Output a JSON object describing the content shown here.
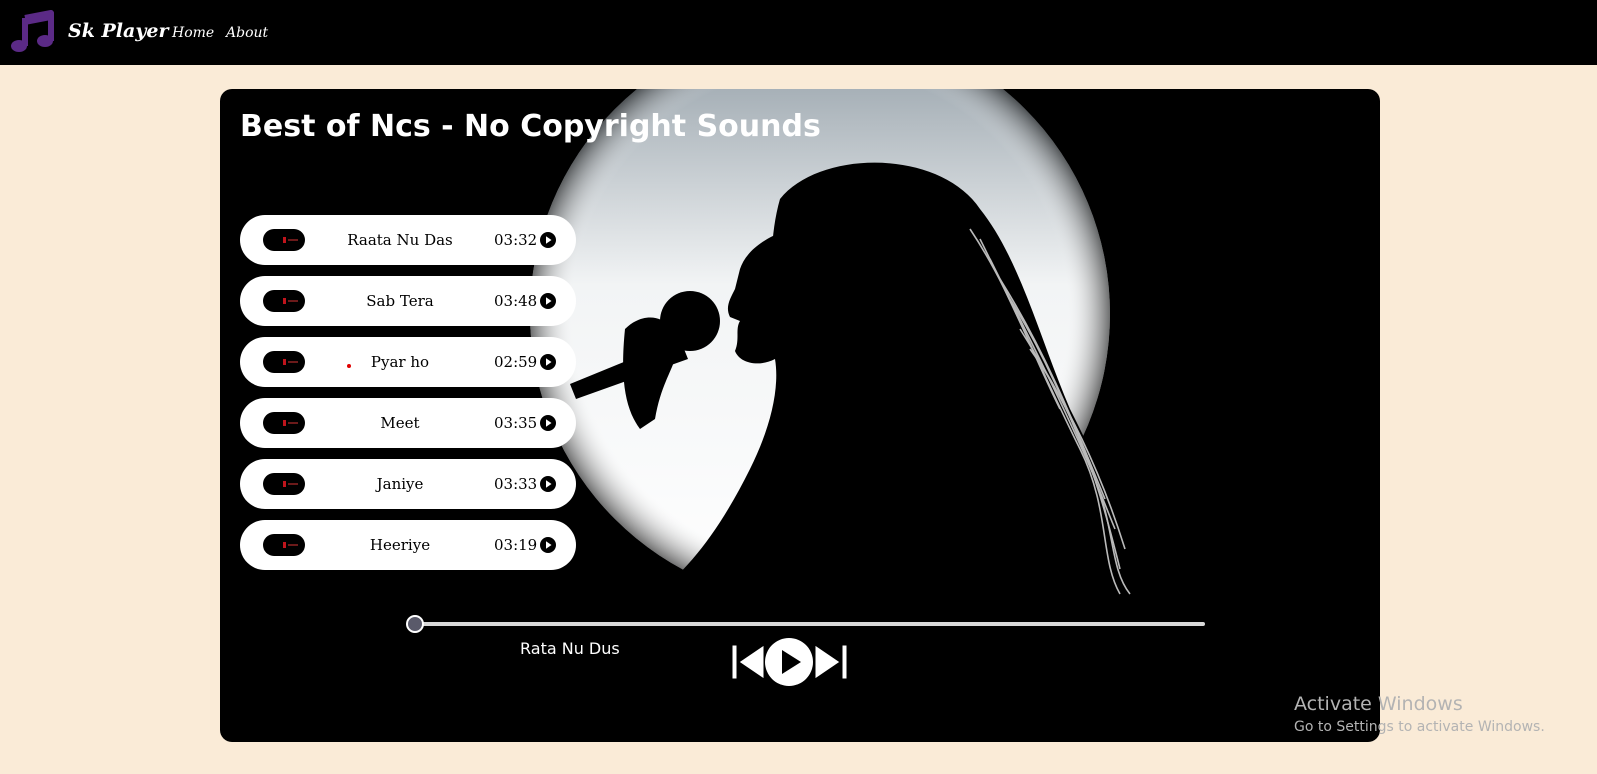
{
  "navbar": {
    "brand": "Sk Player",
    "links": [
      {
        "label": "Home"
      },
      {
        "label": "About"
      }
    ],
    "logo_icon": "music-note-icon",
    "logo_color": "#5b2a86"
  },
  "player": {
    "title": "Best of Ncs - No Copyright Sounds",
    "songs": [
      {
        "name": "Raata Nu Das",
        "duration": "03:32"
      },
      {
        "name": "Sab Tera",
        "duration": "03:48"
      },
      {
        "name": "Pyar ho",
        "duration": "02:59"
      },
      {
        "name": "Meet",
        "duration": "03:35"
      },
      {
        "name": "Janiye",
        "duration": "03:33"
      },
      {
        "name": "Heeriye",
        "duration": "03:19"
      }
    ],
    "now_playing": "Rata Nu Dus",
    "progress_fraction": 0,
    "controls": {
      "prev_icon": "previous-icon",
      "play_icon": "play-icon",
      "next_icon": "next-icon"
    }
  },
  "watermark": {
    "title": "Activate Windows",
    "subtitle": "Go to Settings to activate Windows."
  },
  "colors": {
    "page_background": "#faebd7",
    "navbar_background": "#000000",
    "container_background": "#000000"
  }
}
